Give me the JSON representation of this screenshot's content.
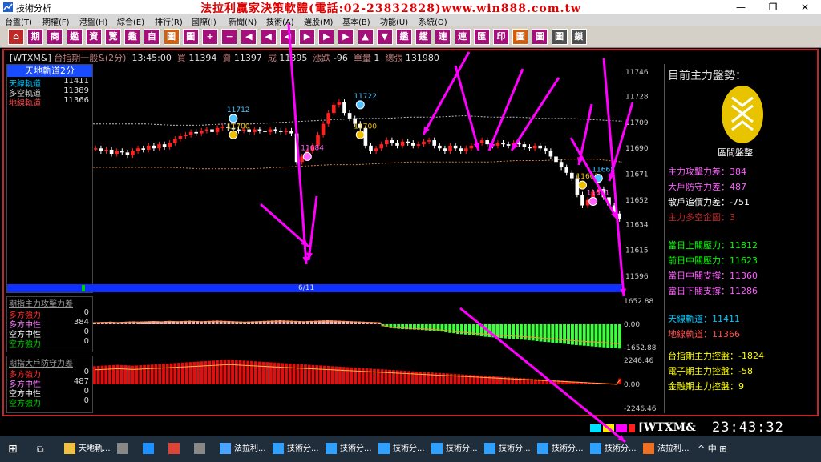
{
  "window": {
    "title": "技術分析",
    "banner": "法拉利贏家決策軟體(電話:02-23832828)www.win888.com.tw",
    "minimize": "—",
    "restore": "❐",
    "close": "✕"
  },
  "menu": [
    "台盤(T)",
    "期權(F)",
    "港盤(H)",
    "綜合(E)",
    "排行(R)",
    "國際(I)",
    "新聞(N)",
    "技術(A)",
    "選股(M)",
    "基本(B)",
    "功能(U)",
    "系統(O)"
  ],
  "toolbar": {
    "buttons": [
      "⌂",
      "期",
      "商",
      "鑑",
      "資",
      "覽",
      "鑑",
      "自",
      "圖",
      "圖",
      "+",
      "−",
      "◀",
      "◀",
      "◀",
      "▶",
      "▶",
      "▶",
      "▲",
      "▼",
      "鑑",
      "鑑",
      "連",
      "連",
      "匯",
      "印",
      "圖",
      "圖",
      "圖",
      "鎖"
    ]
  },
  "info": {
    "code": "[WTXM&]",
    "name": "台指期一般&(2分)",
    "time": "13:45:00",
    "buy_label": "買",
    "buy": "11394",
    "sell_label": "賣",
    "sell": "11397",
    "deal_label": "成",
    "deal": "11395",
    "change_label": "漲跌",
    "change": "-96",
    "vol_label": "單量",
    "vol": "1",
    "total_label": "總張",
    "total": "131980"
  },
  "legend1": {
    "title": "天地軌道2分",
    "rows": [
      {
        "label": "天線軌道",
        "value": "11411",
        "color": "#00c8ff"
      },
      {
        "label": "多空軌道",
        "value": "11389",
        "color": "#d8d8d8"
      },
      {
        "label": "地線軌道",
        "value": "11366",
        "color": "#ff5050"
      }
    ]
  },
  "legend2": {
    "title": "期指主力攻擊力差",
    "rows": [
      {
        "label": "多方強力",
        "value": "0",
        "color": "#ff3030"
      },
      {
        "label": "多方中性",
        "value": "384",
        "color": "#ff80ff"
      },
      {
        "label": "空方中性",
        "value": "0",
        "color": "#ffffff"
      },
      {
        "label": "空方強力",
        "value": "0",
        "color": "#00d000"
      }
    ]
  },
  "legend3": {
    "title": "期指大戶防守力差",
    "rows": [
      {
        "label": "多方強力",
        "value": "0",
        "color": "#ff3030"
      },
      {
        "label": "多方中性",
        "value": "487",
        "color": "#ff80ff"
      },
      {
        "label": "空方中性",
        "value": "0",
        "color": "#ffffff"
      },
      {
        "label": "空方強力",
        "value": "0",
        "color": "#00d000"
      }
    ]
  },
  "date_label": "6/11",
  "chart_data": [
    {
      "type": "candlestick",
      "y_ticks": [
        "11746",
        "11728",
        "11709",
        "11690",
        "11671",
        "11652",
        "11634",
        "11615",
        "11596"
      ],
      "ylim": [
        11590,
        11752
      ],
      "annotations": [
        {
          "text": "11712",
          "color": "#4fc3ff",
          "x_index": 26,
          "y": 11712
        },
        {
          "text": "11700",
          "color": "#f0c000",
          "x_index": 26,
          "y": 11700
        },
        {
          "text": "11684",
          "color": "#ff60ff",
          "x_index": 40,
          "y": 11684
        },
        {
          "text": "11722",
          "color": "#4fc3ff",
          "x_index": 50,
          "y": 11722
        },
        {
          "text": "11700",
          "color": "#f0c000",
          "x_index": 50,
          "y": 11700
        },
        {
          "text": "11663",
          "color": "#f0c000",
          "x_index": 92,
          "y": 11663
        },
        {
          "text": "11668",
          "color": "#4fc3ff",
          "x_index": 95,
          "y": 11668
        },
        {
          "text": "11651",
          "color": "#ff60ff",
          "x_index": 94,
          "y": 11651
        }
      ],
      "closes": [
        11690,
        11688,
        11689,
        11686,
        11688,
        11687,
        11685,
        11688,
        11690,
        11689,
        11692,
        11690,
        11693,
        11691,
        11694,
        11697,
        11699,
        11700,
        11702,
        11701,
        11703,
        11704,
        11702,
        11705,
        11706,
        11705,
        11704,
        11703,
        11704,
        11702,
        11704,
        11703,
        11702,
        11704,
        11703,
        11702,
        11703,
        11701,
        11680,
        11684,
        11688,
        11692,
        11700,
        11708,
        11716,
        11722,
        11724,
        11716,
        11712,
        11708,
        11705,
        11692,
        11688,
        11690,
        11693,
        11696,
        11694,
        11692,
        11695,
        11694,
        11692,
        11693,
        11695,
        11696,
        11692,
        11690,
        11688,
        11692,
        11690,
        11688,
        11690,
        11692,
        11694,
        11696,
        11693,
        11692,
        11694,
        11693,
        11692,
        11694,
        11693,
        11691,
        11690,
        11692,
        11690,
        11688,
        11684,
        11680,
        11676,
        11672,
        11668,
        11656,
        11648,
        11652,
        11658,
        11660,
        11654,
        11648,
        11642,
        11638
      ],
      "trend_upper": [
        11708,
        11708,
        11708,
        11707,
        11707,
        11708,
        11708,
        11709,
        11710,
        11711,
        11712,
        11712,
        11713,
        11713,
        11714,
        11713,
        11713,
        11712,
        11712,
        11711,
        11710
      ],
      "trend_lower": [
        11676,
        11676,
        11676,
        11676,
        11675,
        11675,
        11675,
        11676,
        11677,
        11678,
        11678,
        11679,
        11680,
        11680,
        11680,
        11680,
        11681,
        11681,
        11682,
        11682,
        11680
      ]
    },
    {
      "type": "bar",
      "y_ticks": [
        "1652.88",
        "0.00",
        "-1652.88"
      ],
      "ylim": [
        -1652.88,
        1652.88
      ],
      "values": [
        120,
        130,
        140,
        150,
        160,
        140,
        130,
        150,
        160,
        170,
        180,
        160,
        170,
        180,
        190,
        200,
        190,
        180,
        200,
        210,
        200,
        190,
        200,
        210,
        220,
        210,
        200,
        190,
        200,
        210,
        220,
        230,
        220,
        210,
        200,
        190,
        180,
        170,
        160,
        170,
        180,
        190,
        200,
        210,
        220,
        230,
        240,
        250,
        240,
        230,
        220,
        210,
        200,
        190,
        200,
        210,
        220,
        230,
        240,
        250,
        240,
        230,
        220,
        210,
        200,
        190,
        180,
        170,
        160,
        150,
        140,
        130,
        120,
        -120,
        -180,
        -240,
        -260,
        -280,
        -300,
        -310,
        -320,
        -330,
        -340,
        -360,
        -380,
        -400,
        -420,
        -440,
        -460,
        -500,
        -540,
        -560,
        -600,
        -620,
        -640,
        -680,
        -700,
        -720,
        -750,
        -780,
        -800,
        -820,
        -840,
        -860,
        -880,
        -900,
        -920,
        -940,
        -960,
        -980,
        -1000,
        -1020,
        -1050,
        -1080,
        -1100,
        -1120,
        -1150,
        -1180,
        -1200,
        -1220,
        -1250,
        -1280,
        -1300,
        -1320,
        -1340,
        -1360,
        -1380,
        -1400,
        -1420,
        -1440,
        -1460,
        -1480,
        -1500,
        -1520
      ]
    },
    {
      "type": "bar",
      "y_ticks": [
        "2246.46",
        "0.00",
        "-2246.46"
      ],
      "ylim": [
        -2246.46,
        2246.46
      ],
      "values": [
        1500,
        1520,
        1540,
        1560,
        1580,
        1600,
        1620,
        1600,
        1580,
        1560,
        1540,
        1560,
        1580,
        1600,
        1620,
        1640,
        1660,
        1680,
        1700,
        1720,
        1740,
        1760,
        1780,
        1800,
        1820,
        1840,
        1860,
        1880,
        1900,
        1920,
        1940,
        1960,
        1980,
        2000,
        2020,
        2040,
        2020,
        2000,
        1980,
        1960,
        1940,
        1920,
        1900,
        1880,
        1860,
        1840,
        1820,
        1800,
        1780,
        1760,
        1740,
        1720,
        1700,
        1680,
        1660,
        1640,
        1620,
        1600,
        1580,
        1560,
        1540,
        1520,
        1500,
        1480,
        1460,
        1440,
        1420,
        1400,
        1380,
        1360,
        1340,
        1320,
        1300,
        1280,
        1260,
        1240,
        1220,
        1200,
        1180,
        1160,
        1140,
        1120,
        1100,
        1080,
        1060,
        1040,
        1020,
        1000,
        980,
        960,
        940,
        920,
        900,
        880,
        860,
        840,
        820,
        800,
        780,
        760,
        740,
        720,
        700,
        680,
        660,
        640,
        620,
        600,
        580,
        560,
        540,
        520,
        500,
        480,
        460,
        440,
        420,
        400,
        380,
        360,
        340,
        320,
        300,
        280,
        260,
        240,
        220,
        200,
        180,
        160,
        140,
        120,
        100,
        80,
        60,
        40,
        20,
        487
      ]
    }
  ],
  "right_panel": {
    "title": "目前主力盤勢：",
    "state": "區間盤整",
    "lines1": [
      {
        "label": "主力攻擊力差：",
        "value": "384",
        "color": "#ff60ff"
      },
      {
        "label": "大戶防守力差：",
        "value": "487",
        "color": "#ff60ff"
      },
      {
        "label": "散戶追價力差：",
        "value": "-751",
        "color": "#ffffff"
      },
      {
        "label": "主力多空企圖：",
        "value": "3",
        "color": "#c02828"
      }
    ],
    "lines2": [
      {
        "label": "當日上關壓力：",
        "value": "11812",
        "color": "#00ff00"
      },
      {
        "label": "前日中關壓力：",
        "value": "11623",
        "color": "#00ff00"
      },
      {
        "label": "當日中關支撐：",
        "value": "11360",
        "color": "#ff60ff"
      },
      {
        "label": "當日下關支撐：",
        "value": "11286",
        "color": "#ff60ff"
      }
    ],
    "lines3": [
      {
        "label": "天線軌道：",
        "value": "11411",
        "color": "#00c8ff"
      },
      {
        "label": "地線軌道：",
        "value": "11366",
        "color": "#ff5050"
      }
    ],
    "lines4": [
      {
        "label": "台指期主力控盤：",
        "value": "-1824",
        "color": "#ffff00"
      },
      {
        "label": "電子期主力控盤：",
        "value": "-58",
        "color": "#ffff00"
      },
      {
        "label": "金融期主力控盤：",
        "value": "9",
        "color": "#ffff00"
      }
    ]
  },
  "status": {
    "code": "[WTXM&",
    "clock": "23:43:32"
  },
  "taskbar": {
    "items": [
      {
        "label": "天地軌...",
        "color": "#f0c040"
      },
      {
        "label": "",
        "color": "#888"
      },
      {
        "label": "",
        "color": "#1e90ff"
      },
      {
        "label": "",
        "color": "#db4437"
      },
      {
        "label": "",
        "color": "#888"
      },
      {
        "label": "法拉利...",
        "color": "#4aa3ff"
      },
      {
        "label": "技術分...",
        "color": "#30a0ff"
      },
      {
        "label": "技術分...",
        "color": "#30a0ff"
      },
      {
        "label": "技術分...",
        "color": "#30a0ff"
      },
      {
        "label": "技術分...",
        "color": "#30a0ff"
      },
      {
        "label": "技術分...",
        "color": "#30a0ff"
      },
      {
        "label": "技術分...",
        "color": "#30a0ff"
      },
      {
        "label": "技術分...",
        "color": "#30a0ff"
      },
      {
        "label": "法拉利...",
        "color": "#f07020"
      }
    ],
    "tray": [
      "^",
      "中",
      "⊞"
    ],
    "ime": "中"
  },
  "accent_arrow_color": "#ff00ff"
}
